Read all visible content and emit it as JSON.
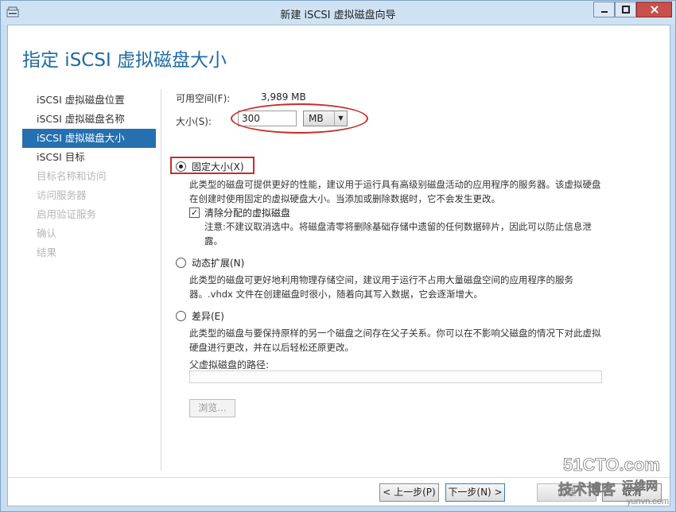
{
  "window": {
    "title": "新建 iSCSI 虚拟磁盘向导"
  },
  "page": {
    "title": "指定 iSCSI 虚拟磁盘大小"
  },
  "nav": {
    "items": [
      {
        "label": "iSCSI 虚拟磁盘位置",
        "state": "normal"
      },
      {
        "label": "iSCSI 虚拟磁盘名称",
        "state": "normal"
      },
      {
        "label": "iSCSI 虚拟磁盘大小",
        "state": "active"
      },
      {
        "label": "iSCSI 目标",
        "state": "normal"
      },
      {
        "label": "目标名称和访问",
        "state": "disabled"
      },
      {
        "label": "访问服务器",
        "state": "disabled"
      },
      {
        "label": "启用验证服务",
        "state": "disabled"
      },
      {
        "label": "确认",
        "state": "disabled"
      },
      {
        "label": "结果",
        "state": "disabled"
      }
    ]
  },
  "form": {
    "available_label": "可用空间(F):",
    "available_value": "3,989 MB",
    "size_label": "大小(S):",
    "size_value": "300",
    "unit_value": "MB",
    "fixed": {
      "label": "固定大小(X)",
      "selected": true,
      "description": "此类型的磁盘可提供更好的性能，建议用于运行具有高级别磁盘活动的应用程序的服务器。该虚拟硬盘在创建时使用固定的虚拟硬盘大小。当添加或删除数据时，它不会发生更改。",
      "clear_label": "清除分配的虚拟磁盘",
      "clear_checked": true,
      "clear_note": "注意:不建议取消选中。将磁盘清零将删除基础存储中遗留的任何数据碎片，因此可以防止信息泄露。"
    },
    "dynamic": {
      "label": "动态扩展(N)",
      "selected": false,
      "description": "此类型的磁盘可更好地利用物理存储空间，建议用于运行不占用大量磁盘空间的应用程序的服务器。.vhdx 文件在创建磁盘时很小，随着向其写入数据，它会逐渐增大。"
    },
    "diff": {
      "label": "差异(E)",
      "selected": false,
      "description": "此类型的磁盘与要保持原样的另一个磁盘之间存在父子关系。你可以在不影响父磁盘的情况下对此虚拟硬盘进行更改，并在以后轻松还原更改。",
      "parent_path_label": "父虚拟磁盘的路径:",
      "parent_path_value": "",
      "browse_label": "浏览..."
    }
  },
  "buttons": {
    "prev": "< 上一步(P)",
    "next": "下一步(N) >",
    "create": "创建",
    "cancel": "取消"
  },
  "watermark": {
    "line1": "51CTO.com",
    "line2": "技术博客",
    "line3": "运维网",
    "line4": "yunvn.com"
  },
  "colors": {
    "accent": "#2470b0",
    "title": "#1f6aa3",
    "annotation": "#c72d2a"
  }
}
